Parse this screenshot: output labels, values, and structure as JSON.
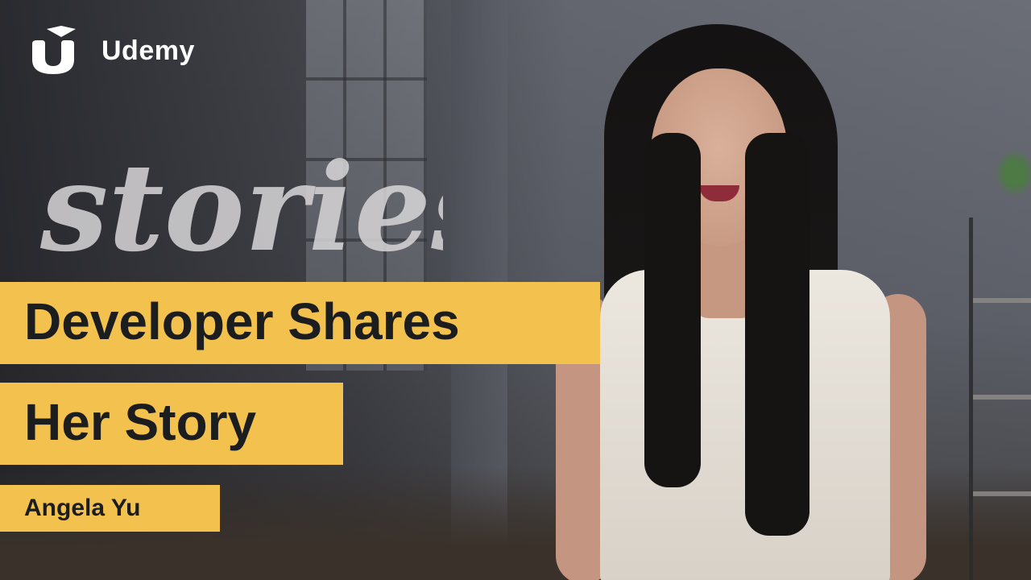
{
  "brand": {
    "name": "Udemy",
    "icon": "udemy-u-logo-icon",
    "color": "#ffffff"
  },
  "series_tag": "stories",
  "headline": {
    "line1": "Developer Shares",
    "line2": "Her Story"
  },
  "speaker": {
    "name": "Angela Yu"
  },
  "colors": {
    "accent": "#f2c14e",
    "text_dark": "#1c1d1f",
    "tag": "#d8d6d8"
  }
}
